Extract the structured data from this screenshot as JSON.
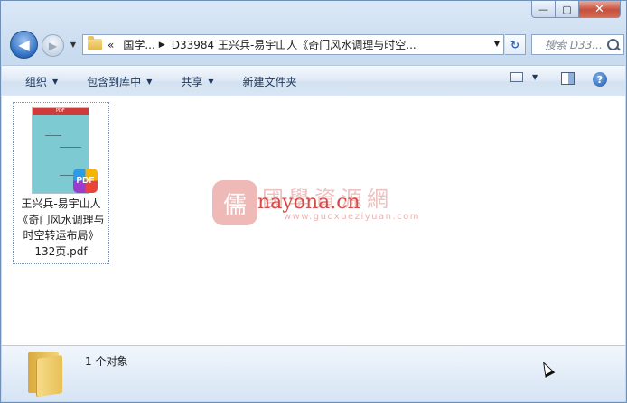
{
  "window": {
    "caption_buttons": {
      "minimize": "—",
      "maximize": "▢",
      "close": "✕"
    }
  },
  "nav": {
    "back_icon": "arrow-left-icon",
    "forward_icon": "arrow-right-icon",
    "breadcrumb_overflow": "«",
    "breadcrumb_sep": "▶",
    "breadcrumb": [
      "国学...",
      "D33984 王兴兵-易宇山人《奇门风水调理与时空..."
    ],
    "search_placeholder": "搜索 D33..."
  },
  "toolbar": {
    "organize": "组织",
    "include_in_library": "包含到库中",
    "share": "共享",
    "new_folder": "新建文件夹"
  },
  "content": {
    "files": [
      {
        "name_lines": [
          "王兴兵-易宇山人",
          "《奇门风水调理与",
          "时空转运布局》",
          "132页.pdf"
        ],
        "thumb_band": "PDF",
        "badge": "PDF"
      }
    ],
    "watermark": {
      "logo_char": "儒",
      "cn": "國學資源網",
      "en": "nayona.cn",
      "url": "www.guoxueziyuan.com"
    }
  },
  "details": {
    "count": "1 个对象"
  }
}
